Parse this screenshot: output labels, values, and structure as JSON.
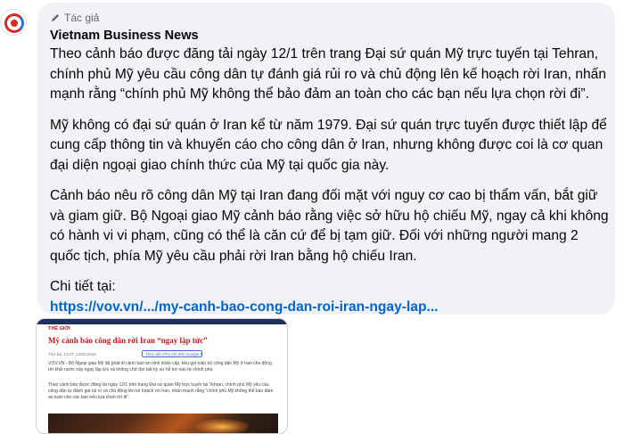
{
  "post": {
    "author_role": "Tác giả",
    "author_name": "Vietnam Business News",
    "paragraphs": [
      "Theo cảnh báo được đăng tải ngày 12/1 trên trang Đại sứ quán Mỹ trực tuyến tại Tehran, chính phủ Mỹ yêu cầu công dân tự đánh giá rủi ro và chủ động lên kế hoạch rời Iran, nhấn mạnh rằng “chính phủ Mỹ không thể bảo đảm an toàn cho các bạn nếu lựa chọn rời đi”.",
      "Mỹ không có đại sứ quán ở Iran kể từ năm 1979. Đại sứ quán trực tuyến được thiết lập để cung cấp thông tin và khuyến cáo cho công dân ở Iran, nhưng không được coi là cơ quan đại diện ngoại giao chính thức của Mỹ tại quốc gia này.",
      "Cảnh báo nêu rõ công dân Mỹ tại Iran đang đối mặt với nguy cơ cao bị thẩm vấn, bắt giữ và giam giữ. Bộ Ngoại giao Mỹ cảnh báo rằng việc sở hữu hộ chiếu Mỹ, ngay cả khi không có hành vi vi phạm, cũng có thể là căn cứ để bị tạm giữ. Đối với những người mang 2 quốc tịch, phía Mỹ yêu cầu phải rời Iran bằng hộ chiếu Iran."
    ],
    "detail_label": "Chi tiết tại:",
    "detail_link": "https://vov.vn/.../my-canh-bao-cong-dan-roi-iran-ngay-lap..."
  },
  "preview": {
    "section": "THẾ GIỚI",
    "headline": "Mỹ cảnh báo công dân rời Iran “ngay lập tức”",
    "meta": "Thứ Ba, 13:27, 13/01/2026",
    "gnews_label": "Theo dõi VOV.VN trên Google News",
    "para1": "VOV.VN - Bộ Ngoại giao Mỹ đã phát đi cảnh báo an ninh khẩn cấp, kêu gọi toàn bộ công dân Mỹ ở Iran cho động rời khỏi nước này ngay lập tức và không chờ đợi bất kỳ sự hỗ trợ nào từ chính phủ.",
    "para2": "Theo cảnh báo được đăng tải ngày 12/1 trên trang Đại sứ quán Mỹ trực tuyến tại Tehran, chính phủ Mỹ yêu cầu công dân tự đánh giá rủi ro và chủ động lên kế hoạch rời Iran, nhấn mạnh rằng “chính phủ Mỹ không thể bảo đảm an toàn cho các bạn nếu lựa chọn rời đi”."
  },
  "colors": {
    "bubble": "#f0f2f5",
    "link": "#0064d1",
    "secondary_text": "#65676b",
    "vov_red": "#c4161c"
  },
  "icons": {
    "author_badge": "pencil-icon",
    "avatar": "vov-logo"
  }
}
